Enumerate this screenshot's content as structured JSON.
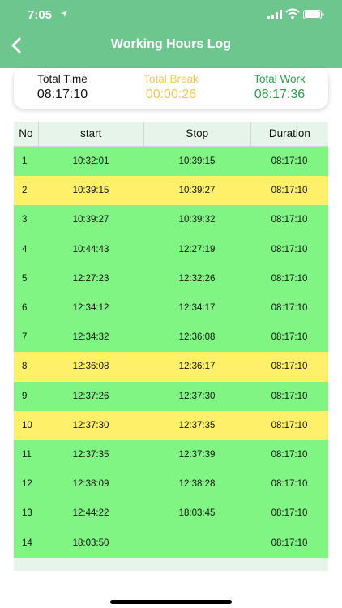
{
  "status": {
    "time": "7:05"
  },
  "header": {
    "title": "Working Hours Log"
  },
  "summary": {
    "total_time": {
      "label": "Total Time",
      "value": "08:17:10"
    },
    "total_break": {
      "label": "Total Break",
      "value": "00:00:26"
    },
    "total_work": {
      "label": "Total Work",
      "value": "08:17:36"
    }
  },
  "colors": {
    "green": "#80f583",
    "yellow": "#fff06a",
    "header": "#6cc68e"
  },
  "table": {
    "headers": [
      "No",
      "start",
      "Stop",
      "Duration"
    ],
    "rows": [
      {
        "no": "1",
        "start": "10:32:01",
        "stop": "10:39:15",
        "duration": "08:17:10",
        "type": "green"
      },
      {
        "no": "2",
        "start": "10:39:15",
        "stop": "10:39:27",
        "duration": "08:17:10",
        "type": "yellow"
      },
      {
        "no": "3",
        "start": "10:39:27",
        "stop": "10:39:32",
        "duration": "08:17:10",
        "type": "green"
      },
      {
        "no": "4",
        "start": "10:44:43",
        "stop": "12:27:19",
        "duration": "08:17:10",
        "type": "green"
      },
      {
        "no": "5",
        "start": "12:27:23",
        "stop": "12:32:26",
        "duration": "08:17:10",
        "type": "green"
      },
      {
        "no": "6",
        "start": "12:34:12",
        "stop": "12:34:17",
        "duration": "08:17:10",
        "type": "green"
      },
      {
        "no": "7",
        "start": "12:34:32",
        "stop": "12:36:08",
        "duration": "08:17:10",
        "type": "green"
      },
      {
        "no": "8",
        "start": "12:36:08",
        "stop": "12:36:17",
        "duration": "08:17:10",
        "type": "yellow"
      },
      {
        "no": "9",
        "start": "12:37:26",
        "stop": "12:37:30",
        "duration": "08:17:10",
        "type": "green"
      },
      {
        "no": "10",
        "start": "12:37:30",
        "stop": "12:37:35",
        "duration": "08:17:10",
        "type": "yellow"
      },
      {
        "no": "11",
        "start": "12:37:35",
        "stop": "12:37:39",
        "duration": "08:17:10",
        "type": "green"
      },
      {
        "no": "12",
        "start": "12:38:09",
        "stop": "12:38:28",
        "duration": "08:17:10",
        "type": "green"
      },
      {
        "no": "13",
        "start": "12:44:22",
        "stop": "18:03:45",
        "duration": "08:17:10",
        "type": "green"
      },
      {
        "no": "14",
        "start": "18:03:50",
        "stop": "",
        "duration": "08:17:10",
        "type": "green"
      }
    ]
  }
}
